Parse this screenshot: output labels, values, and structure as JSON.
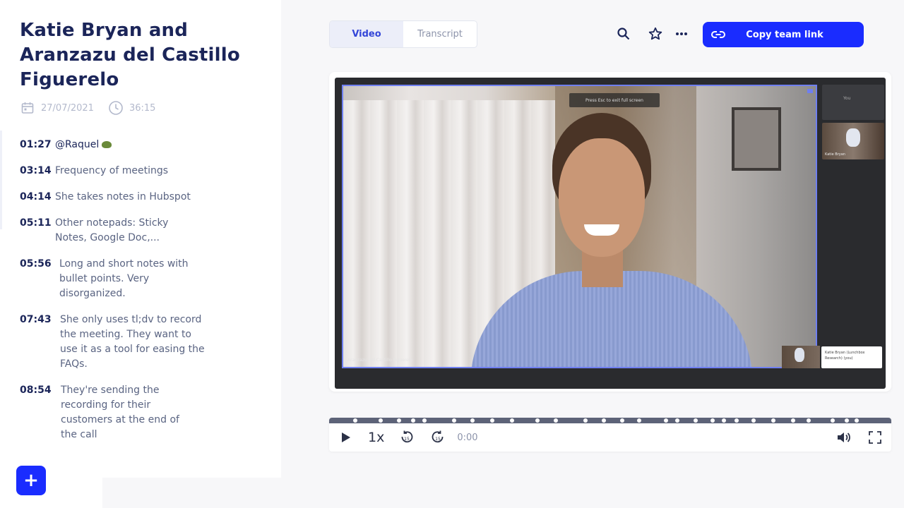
{
  "meeting": {
    "title": "Katie Bryan and Aranzazu del Castillo Figuerelo",
    "date": "27/07/2021",
    "duration": "36:15"
  },
  "notes": [
    {
      "time": "01:27",
      "text": "@Raquel",
      "highlight": true
    },
    {
      "time": "03:14",
      "text": "Frequency of meetings"
    },
    {
      "time": "04:14",
      "text": "She takes notes in Hubspot"
    },
    {
      "time": "05:11",
      "text": "Other notepads: Sticky Notes, Google Doc,..."
    },
    {
      "time": "05:56",
      "text": "Long and short notes with bullet points. Very disorganized."
    },
    {
      "time": "07:43",
      "text": "She only uses tl;dv to record the meeting. They want to use it as a tool for easing the FAQs."
    },
    {
      "time": "08:54",
      "text": "They're sending the recording for their customers at the end of the call"
    }
  ],
  "sidebar": {
    "add_label": "+"
  },
  "tabs": [
    {
      "label": "Video",
      "active": true
    },
    {
      "label": "Transcript",
      "active": false
    }
  ],
  "toolbar": {
    "icons": [
      "search-icon",
      "star-icon",
      "more-icon"
    ],
    "copy_team_link_label": "Copy team link"
  },
  "player": {
    "esc_hint": "Press Esc to exit full screen",
    "speaker_name": "Aranzazu del Castillo Figuerelo",
    "side_tile_name": "You",
    "side_tile_2_name": "Katie Bryan",
    "self_card": "Katie Bryan (Lunchbox Research) (you)",
    "speed": "1x",
    "current_time": "0:00",
    "marker_count": 28
  },
  "colors": {
    "accent": "#1a2cff",
    "title": "#1b2559",
    "track": "#5d6378"
  }
}
